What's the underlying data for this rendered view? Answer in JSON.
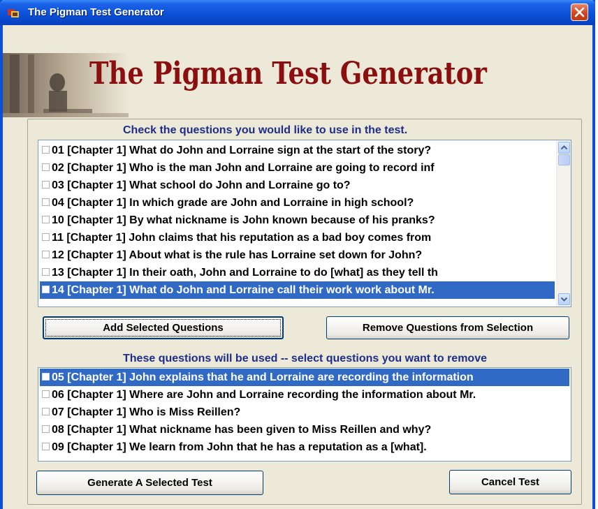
{
  "window": {
    "title": "The Pigman Test Generator"
  },
  "banner": {
    "title": "The Pigman Test Generator"
  },
  "available": {
    "instruction": "Check the questions you would like to use in the test.",
    "items": [
      "01 [Chapter 1] What do John and Lorraine sign at the start of the story?",
      "02 [Chapter 1] Who is the man John and Lorraine are going to record inf",
      "03 [Chapter 1] What school do John and Lorraine go to?",
      "04 [Chapter 1] In which grade are John and Lorraine in high school?",
      "10 [Chapter 1] By what nickname is John known because of his pranks?",
      "11 [Chapter 1] John claims that his reputation as a bad boy comes from",
      "12 [Chapter 1] About what is the rule has Lorraine set down for John?",
      "13 [Chapter 1] In their oath, John and Lorraine to do [what] as they tell th",
      "14 [Chapter 1] What do John and Lorraine call their work work about Mr."
    ],
    "selected_index": 8
  },
  "buttons": {
    "add": "Add Selected Questions",
    "remove": "Remove Questions from Selection",
    "generate": "Generate A Selected Test",
    "cancel": "Cancel Test"
  },
  "selected": {
    "instruction": "These questions will be used --  select questions you want to remove",
    "items": [
      "05 [Chapter 1] John explains that he and Lorraine are recording the information",
      "06 [Chapter 1] Where are John and Lorraine recording the information about Mr.",
      "07 [Chapter 1] Who is Miss Reillen?",
      "08 [Chapter 1] What nickname has been given to Miss Reillen and why?",
      "09 [Chapter 1] We learn from John that he has a reputation as a [what]."
    ],
    "selected_index": 0
  },
  "colors": {
    "title_red": "#8b0f0f",
    "instruction_blue": "#1f2d8a",
    "selection": "#316ac5"
  },
  "icons": [
    "app-icon",
    "close-icon",
    "scroll-up-icon",
    "scroll-down-icon",
    "checkbox-icon"
  ]
}
